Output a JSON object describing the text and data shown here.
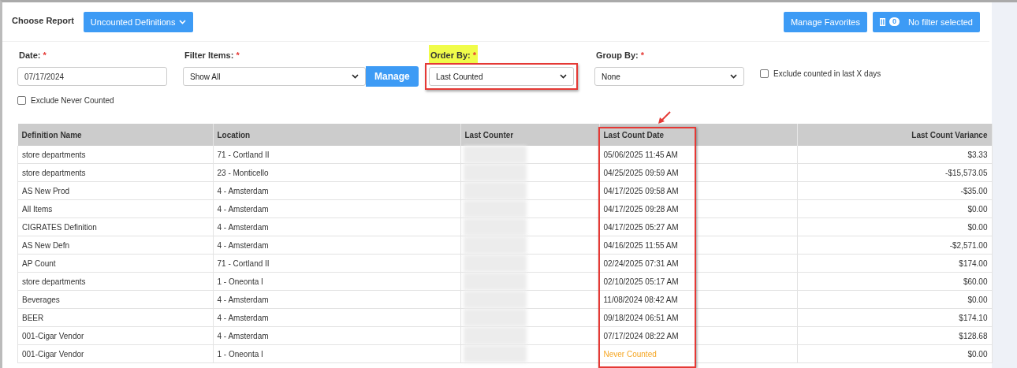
{
  "toolbar": {
    "label": "Choose Report",
    "report_button": "Uncounted Definitions",
    "favorites_button": "Manage Favorites",
    "filter_count": "0",
    "filter_button": "No filter selected"
  },
  "form": {
    "date": {
      "label": "Date:",
      "required": "*",
      "value": "07/17/2024"
    },
    "filter_items": {
      "label": "Filter Items:",
      "required": "*",
      "value": "Show All",
      "button": "Manage"
    },
    "order_by": {
      "label": "Order By:",
      "required": "*",
      "value": "Last Counted",
      "highlighted": true,
      "outlined": true
    },
    "group_by": {
      "label": "Group By:",
      "required": "*",
      "value": "None"
    },
    "exclude_recent": {
      "label": "Exclude counted in last X days",
      "checked": false
    },
    "exclude_never": {
      "label": "Exclude Never Counted",
      "checked": false
    }
  },
  "table": {
    "columns": [
      {
        "label": "Definition Name",
        "outlined": false
      },
      {
        "label": "Location",
        "outlined": false
      },
      {
        "label": "Last Counter",
        "outlined": false
      },
      {
        "label": "Last Count Date",
        "outlined": true
      },
      {
        "label": "Last Count Variance",
        "outlined": false
      }
    ],
    "rows": [
      {
        "name": "store departments",
        "location": "71 - Cortland II",
        "date": "05/06/2025 11:45 AM",
        "never_counted": false,
        "variance": "$3.33"
      },
      {
        "name": "store departments",
        "location": "23 - Monticello",
        "date": "04/25/2025 09:59 AM",
        "never_counted": false,
        "variance": "-$15,573.05"
      },
      {
        "name": "AS New Prod",
        "location": "4 - Amsterdam",
        "date": "04/17/2025 09:58 AM",
        "never_counted": false,
        "variance": "-$35.00"
      },
      {
        "name": "All Items",
        "location": "4 - Amsterdam",
        "date": "04/17/2025 09:28 AM",
        "never_counted": false,
        "variance": "$0.00"
      },
      {
        "name": "CIGRATES Definition",
        "location": "4 - Amsterdam",
        "date": "04/17/2025 05:27 AM",
        "never_counted": false,
        "variance": "$0.00"
      },
      {
        "name": "AS New Defn",
        "location": "4 - Amsterdam",
        "date": "04/16/2025 11:55 AM",
        "never_counted": false,
        "variance": "-$2,571.00"
      },
      {
        "name": "AP Count",
        "location": "71 - Cortland II",
        "date": "02/24/2025 07:31 AM",
        "never_counted": false,
        "variance": "$174.00"
      },
      {
        "name": "store departments",
        "location": "1 - Oneonta I",
        "date": "02/10/2025 05:17 AM",
        "never_counted": false,
        "variance": "$60.00"
      },
      {
        "name": "Beverages",
        "location": "4 - Amsterdam",
        "date": "11/08/2024 08:42 AM",
        "never_counted": false,
        "variance": "$0.00"
      },
      {
        "name": "BEER",
        "location": "4 - Amsterdam",
        "date": "09/18/2024 06:51 AM",
        "never_counted": false,
        "variance": "$174.10"
      },
      {
        "name": "001-Cigar Vendor",
        "location": "4 - Amsterdam",
        "date": "07/17/2024 08:22 AM",
        "never_counted": false,
        "variance": "$128.68"
      },
      {
        "name": "001-Cigar Vendor",
        "location": "1 - Oneonta I",
        "date": "Never Counted",
        "never_counted": true,
        "variance": "$0.00"
      }
    ]
  }
}
